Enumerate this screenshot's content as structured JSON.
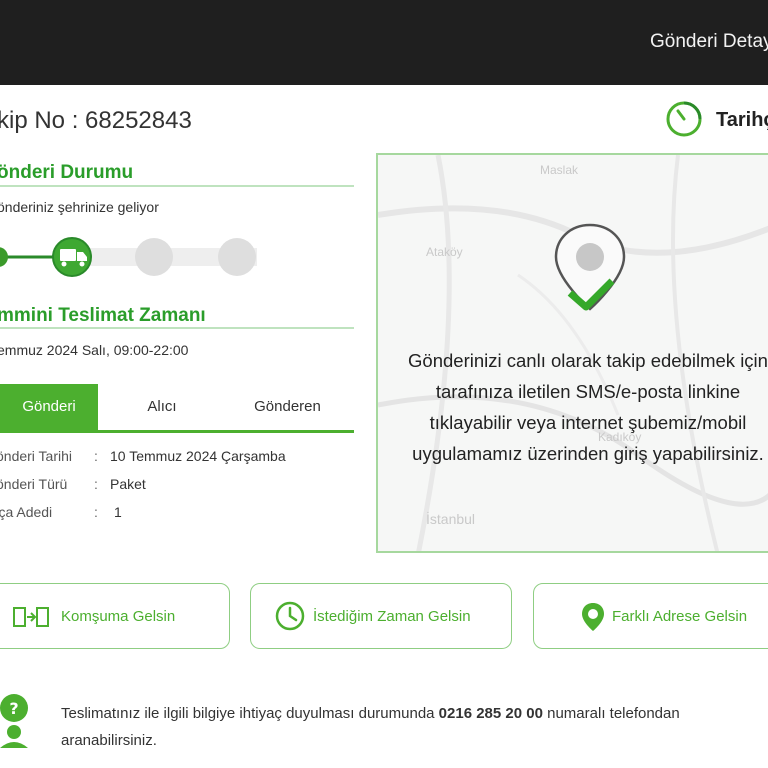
{
  "header": {
    "title": "Gönderi Detayı"
  },
  "tracking": {
    "label_text": "kip No : 68252843",
    "history_label": "Tarihçe"
  },
  "status": {
    "title": "önderi Durumu",
    "message": "önderiniz şehrinize geliyor",
    "steps_total": 4,
    "current_step": 2
  },
  "delivery": {
    "title": "mmini Teslimat Zamanı",
    "time": "emmuz 2024 Salı, 09:00-22:00"
  },
  "tabs": [
    {
      "label": "Gönderi"
    },
    {
      "label": "Alıcı"
    },
    {
      "label": "Gönderen"
    }
  ],
  "details": [
    {
      "key": "önderi Tarihi",
      "value": "10 Temmuz 2024 Çarşamba"
    },
    {
      "key": "önderi Türü",
      "value": "Paket"
    },
    {
      "key": "arça Adedi",
      "value": "1"
    }
  ],
  "map": {
    "message": "Gönderinizi canlı olarak takip edebilmek için tarafınıza iletilen SMS/e-posta linkine tıklayabilir veya internet şubemiz/mobil uygulamamız üzerinden giriş yapabilirsiniz.",
    "places": [
      "Maslak",
      "Ataköy",
      "İstanbul",
      "Kadıköy"
    ]
  },
  "actions": [
    {
      "label": "Komşuma Gelsin",
      "icon": "neighbor-icon"
    },
    {
      "label": "İstediğim Zaman Gelsin",
      "icon": "clock-icon"
    },
    {
      "label": "Farklı Adrese Gelsin",
      "icon": "location-icon"
    }
  ],
  "info": {
    "before": "Teslimatınız ile ilgili bilgiye ihtiyaç duyulması durumunda ",
    "phone": "0216 285 20 00",
    "after": " numaralı telefondan aranabilirsiniz."
  },
  "colors": {
    "accent": "#4caf2f",
    "header_bg": "#1f1f1f"
  }
}
